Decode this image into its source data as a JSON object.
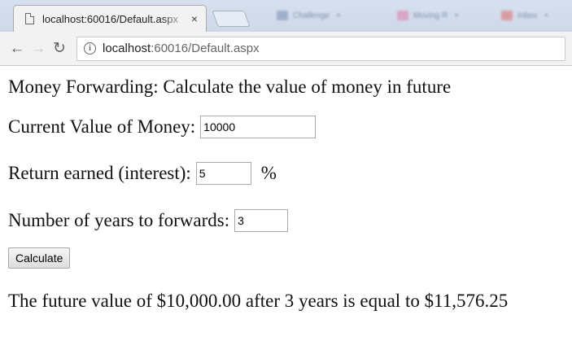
{
  "browser": {
    "active_tab": {
      "title": "localhost:60016/Default.aspx",
      "close_glyph": "×"
    },
    "background_tabs": [
      {
        "title": "Challenge",
        "color": "#7a8cb3"
      },
      {
        "title": "Moving R",
        "color": "#e07aa8"
      },
      {
        "title": "Inbox",
        "color": "#e06a6a"
      }
    ],
    "address": {
      "host": "localhost",
      "path": ":60016/Default.aspx"
    },
    "icons": {
      "page": "page-icon",
      "back": "back-arrow-icon",
      "forward": "forward-arrow-icon",
      "reload": "reload-icon",
      "info": "info-icon"
    }
  },
  "page": {
    "heading": "Money Forwarding: Calculate the value of money in future",
    "current_value": {
      "label": "Current Value of Money:",
      "value": "10000"
    },
    "interest": {
      "label": "Return earned (interest):",
      "value": "5",
      "unit": "%"
    },
    "years": {
      "label": "Number of years to forwards:",
      "value": "3"
    },
    "button": "Calculate",
    "result": "The future value of $10,000.00 after 3 years is equal to $11,576.25"
  }
}
